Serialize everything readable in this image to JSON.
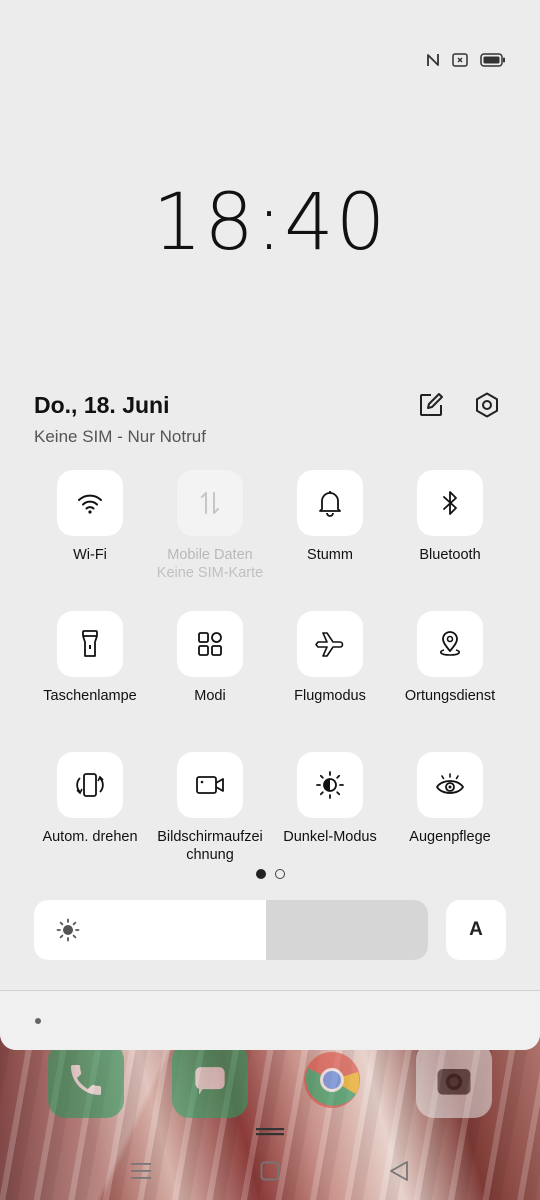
{
  "status_bar": {
    "icons": [
      "nfc-icon",
      "no-sim-icon",
      "battery-icon"
    ]
  },
  "clock": {
    "time": "18:40"
  },
  "header": {
    "date": "Do., 18. Juni",
    "sim_status": "Keine SIM - Nur Notruf",
    "edit_icon": "edit-icon",
    "settings_icon": "settings-icon"
  },
  "tiles": [
    {
      "label": "Wi-Fi",
      "icon": "wifi-icon",
      "enabled": true
    },
    {
      "label": "Mobile Daten",
      "sublabel": "Keine SIM-Karte",
      "icon": "mobile-data-icon",
      "enabled": false
    },
    {
      "label": "Stumm",
      "icon": "bell-icon",
      "enabled": true
    },
    {
      "label": "Bluetooth",
      "icon": "bluetooth-icon",
      "enabled": true
    },
    {
      "label": "Taschenlampe",
      "icon": "flashlight-icon",
      "enabled": true
    },
    {
      "label": "Modi",
      "icon": "modes-icon",
      "enabled": true
    },
    {
      "label": "Flugmodus",
      "icon": "airplane-icon",
      "enabled": true
    },
    {
      "label": "Ortungsdienst",
      "icon": "location-icon",
      "enabled": true
    },
    {
      "label": "Autom. drehen",
      "icon": "auto-rotate-icon",
      "enabled": true
    },
    {
      "label": "Bildschirmaufzei chnung",
      "icon": "screen-record-icon",
      "enabled": true
    },
    {
      "label": "Dunkel-Modus",
      "icon": "dark-mode-icon",
      "enabled": true
    },
    {
      "label": "Augenpflege",
      "icon": "eye-care-icon",
      "enabled": true
    }
  ],
  "pages": {
    "current": 1,
    "total": 2
  },
  "brightness": {
    "level_percent": 59,
    "auto_label": "A"
  },
  "dock": [
    "phone-app",
    "messages-app",
    "chrome-app",
    "camera-app"
  ],
  "colors": {
    "panel_bg": "#ececec",
    "tile_bg": "#ffffff",
    "disabled_text": "#b9b9b9"
  }
}
